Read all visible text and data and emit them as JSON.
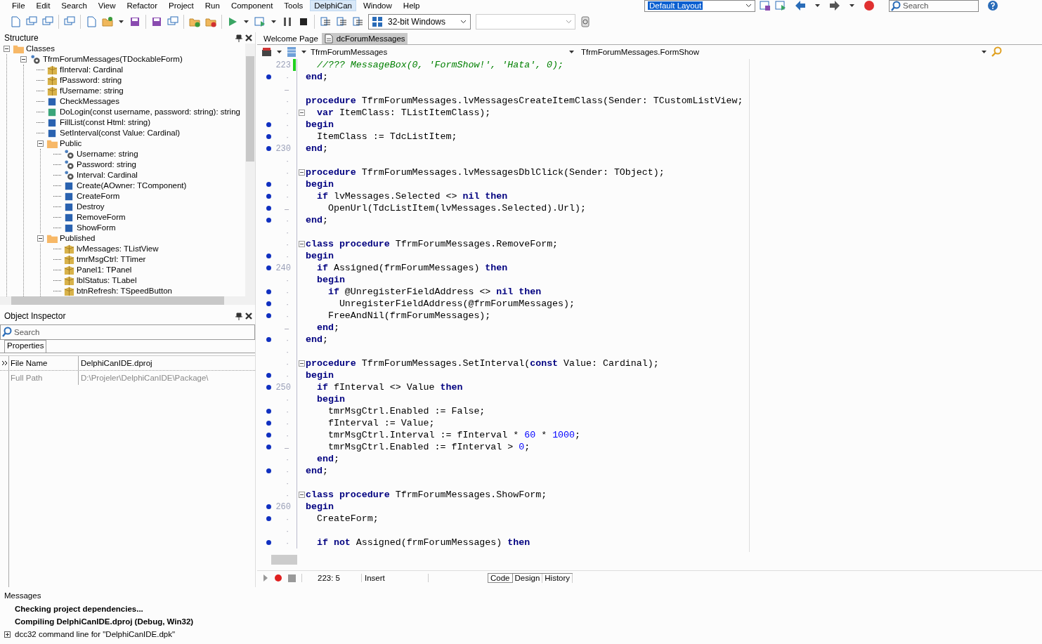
{
  "menu": [
    {
      "label": "File",
      "selected": false
    },
    {
      "label": "Edit",
      "selected": false
    },
    {
      "label": "Search",
      "selected": false
    },
    {
      "label": "View",
      "selected": false
    },
    {
      "label": "Refactor",
      "selected": false
    },
    {
      "label": "Project",
      "selected": false
    },
    {
      "label": "Run",
      "selected": false
    },
    {
      "label": "Component",
      "selected": false
    },
    {
      "label": "Tools",
      "selected": false
    },
    {
      "label": "DelphiCan",
      "selected": true
    },
    {
      "label": "Window",
      "selected": false
    },
    {
      "label": "Help",
      "selected": false
    }
  ],
  "layout_combo": {
    "value": "Default Layout"
  },
  "top_search": {
    "placeholder": "Search"
  },
  "platform_combo": {
    "value": "32-bit Windows"
  },
  "structure": {
    "title": "Structure",
    "tree": [
      {
        "label": "Classes",
        "kind": "folder",
        "expanded": true,
        "children": [
          {
            "label": "TfrmForumMessages(TDockableForm)",
            "kind": "class",
            "expanded": true,
            "children": [
              {
                "label": "fInterval: Cardinal",
                "kind": "field"
              },
              {
                "label": "fPassword: string",
                "kind": "field"
              },
              {
                "label": "fUsername: string",
                "kind": "field"
              },
              {
                "label": "CheckMessages",
                "kind": "method"
              },
              {
                "label": "DoLogin(const username, password: string): string",
                "kind": "function"
              },
              {
                "label": "FillList(const Html: string)",
                "kind": "method"
              },
              {
                "label": "SetInterval(const Value: Cardinal)",
                "kind": "method"
              },
              {
                "label": "Public",
                "kind": "folder",
                "expanded": true,
                "children": [
                  {
                    "label": "Username: string",
                    "kind": "property"
                  },
                  {
                    "label": "Password: string",
                    "kind": "property"
                  },
                  {
                    "label": "Interval: Cardinal",
                    "kind": "property"
                  },
                  {
                    "label": "Create(AOwner: TComponent)",
                    "kind": "method"
                  },
                  {
                    "label": "CreateForm",
                    "kind": "method"
                  },
                  {
                    "label": "Destroy",
                    "kind": "method"
                  },
                  {
                    "label": "RemoveForm",
                    "kind": "method"
                  },
                  {
                    "label": "ShowForm",
                    "kind": "method"
                  }
                ]
              },
              {
                "label": "Published",
                "kind": "folder",
                "expanded": true,
                "children": [
                  {
                    "label": "lvMessages: TListView",
                    "kind": "field"
                  },
                  {
                    "label": "tmrMsgCtrl: TTimer",
                    "kind": "field"
                  },
                  {
                    "label": "Panel1: TPanel",
                    "kind": "field"
                  },
                  {
                    "label": "lblStatus: TLabel",
                    "kind": "field"
                  },
                  {
                    "label": "btnRefresh: TSpeedButton",
                    "kind": "field"
                  }
                ]
              }
            ]
          }
        ]
      }
    ]
  },
  "object_inspector": {
    "title": "Object Inspector",
    "search": {
      "placeholder": "Search"
    },
    "tabs": [
      {
        "label": "Properties",
        "selected": true
      }
    ],
    "rows": [
      {
        "name": "File Name",
        "value": "DelphiCanIDE.dproj",
        "selected": true,
        "disabled": false
      },
      {
        "name": "Full Path",
        "value": "D:\\Projeler\\DelphiCanIDE\\Package\\",
        "selected": false,
        "disabled": true
      }
    ]
  },
  "editor": {
    "tabs": [
      {
        "label": "Welcome Page",
        "selected": false,
        "icon": false
      },
      {
        "label": "dcForumMessages",
        "selected": true,
        "icon": true
      }
    ],
    "class_combo": "TfrmForumMessages",
    "method_combo": "TfrmForumMessages.FormShow",
    "lines": [
      {
        "number": "223",
        "modified": true,
        "code": [
          {
            "kind": "comment",
            "text": "  //??? MessageBox(0, 'FormShow!', 'Hata', 0);"
          }
        ]
      },
      {
        "marker": "·",
        "dot": true,
        "code": [
          {
            "kind": "kw",
            "text": "end"
          },
          {
            "kind": "id",
            "text": ";"
          }
        ]
      },
      {
        "marker": "–"
      },
      {
        "marker": "·",
        "code": [
          {
            "kind": "kw",
            "text": "procedure"
          },
          {
            "kind": "id",
            "text": " TfrmForumMessages.lvMessagesCreateItemClass(Sender: TCustomListView;"
          }
        ]
      },
      {
        "marker": "·",
        "fold": true,
        "code": [
          {
            "kind": "kw",
            "text": "  var"
          },
          {
            "kind": "id",
            "text": " ItemClass: TListItemClass);"
          }
        ]
      },
      {
        "marker": "·",
        "dot": true,
        "code": [
          {
            "kind": "kw",
            "text": "begin"
          }
        ]
      },
      {
        "marker": "·",
        "dot": true,
        "code": [
          {
            "kind": "id",
            "text": "  ItemClass := TdcListItem;"
          }
        ]
      },
      {
        "number": "230",
        "dot": true,
        "code": [
          {
            "kind": "kw",
            "text": "end"
          },
          {
            "kind": "id",
            "text": ";"
          }
        ]
      },
      {
        "marker": "·"
      },
      {
        "marker": "·",
        "fold": true,
        "code": [
          {
            "kind": "kw",
            "text": "procedure"
          },
          {
            "kind": "id",
            "text": " TfrmForumMessages.lvMessagesDblClick(Sender: TObject);"
          }
        ]
      },
      {
        "marker": "·",
        "dot": true,
        "code": [
          {
            "kind": "kw",
            "text": "begin"
          }
        ]
      },
      {
        "marker": "·",
        "dot": true,
        "code": [
          {
            "kind": "kw",
            "text": "  if"
          },
          {
            "kind": "id",
            "text": " lvMessages.Selected <> "
          },
          {
            "kind": "kw",
            "text": "nil then"
          }
        ]
      },
      {
        "marker": "–",
        "dot": true,
        "code": [
          {
            "kind": "id",
            "text": "    OpenUrl(TdcListItem(lvMessages.Selected).Url);"
          }
        ]
      },
      {
        "marker": "·",
        "dot": true,
        "code": [
          {
            "kind": "kw",
            "text": "end"
          },
          {
            "kind": "id",
            "text": ";"
          }
        ]
      },
      {
        "marker": "·"
      },
      {
        "marker": "·",
        "fold": true,
        "code": [
          {
            "kind": "kw",
            "text": "class procedure"
          },
          {
            "kind": "id",
            "text": " TfrmForumMessages.RemoveForm;"
          }
        ]
      },
      {
        "marker": "·",
        "dot": true,
        "code": [
          {
            "kind": "kw",
            "text": "begin"
          }
        ]
      },
      {
        "number": "240",
        "dot": true,
        "code": [
          {
            "kind": "kw",
            "text": "  if"
          },
          {
            "kind": "id",
            "text": " Assigned(frmForumMessages) "
          },
          {
            "kind": "kw",
            "text": "then"
          }
        ]
      },
      {
        "marker": "·",
        "code": [
          {
            "kind": "kw",
            "text": "  begin"
          }
        ]
      },
      {
        "marker": "·",
        "dot": true,
        "code": [
          {
            "kind": "kw",
            "text": "    if"
          },
          {
            "kind": "id",
            "text": " @UnregisterFieldAddress <> "
          },
          {
            "kind": "kw",
            "text": "nil then"
          }
        ]
      },
      {
        "marker": "·",
        "dot": true,
        "code": [
          {
            "kind": "id",
            "text": "      UnregisterFieldAddress(@frmForumMessages);"
          }
        ]
      },
      {
        "marker": "·",
        "dot": true,
        "code": [
          {
            "kind": "id",
            "text": "    FreeAndNil(frmForumMessages);"
          }
        ]
      },
      {
        "marker": "–",
        "code": [
          {
            "kind": "kw",
            "text": "  end"
          },
          {
            "kind": "id",
            "text": ";"
          }
        ]
      },
      {
        "marker": "·",
        "dot": true,
        "code": [
          {
            "kind": "kw",
            "text": "end"
          },
          {
            "kind": "id",
            "text": ";"
          }
        ]
      },
      {
        "marker": "·"
      },
      {
        "marker": "·",
        "fold": true,
        "code": [
          {
            "kind": "kw",
            "text": "procedure"
          },
          {
            "kind": "id",
            "text": " TfrmForumMessages.SetInterval("
          },
          {
            "kind": "kw",
            "text": "const"
          },
          {
            "kind": "id",
            "text": " Value: Cardinal);"
          }
        ]
      },
      {
        "marker": "·",
        "dot": true,
        "code": [
          {
            "kind": "kw",
            "text": "begin"
          }
        ]
      },
      {
        "number": "250",
        "dot": true,
        "code": [
          {
            "kind": "kw",
            "text": "  if"
          },
          {
            "kind": "id",
            "text": " fInterval <> Value "
          },
          {
            "kind": "kw",
            "text": "then"
          }
        ]
      },
      {
        "marker": "·",
        "code": [
          {
            "kind": "kw",
            "text": "  begin"
          }
        ]
      },
      {
        "marker": "·",
        "dot": true,
        "code": [
          {
            "kind": "id",
            "text": "    tmrMsgCtrl.Enabled := False;"
          }
        ]
      },
      {
        "marker": "·",
        "dot": true,
        "code": [
          {
            "kind": "id",
            "text": "    fInterval := Value;"
          }
        ]
      },
      {
        "marker": "·",
        "dot": true,
        "code": [
          {
            "kind": "id",
            "text": "    tmrMsgCtrl.Interval := fInterval * "
          },
          {
            "kind": "num",
            "text": "60"
          },
          {
            "kind": "id",
            "text": " * "
          },
          {
            "kind": "num",
            "text": "1000"
          },
          {
            "kind": "id",
            "text": ";"
          }
        ]
      },
      {
        "marker": "–",
        "dot": true,
        "code": [
          {
            "kind": "id",
            "text": "    tmrMsgCtrl.Enabled := fInterval > "
          },
          {
            "kind": "num",
            "text": "0"
          },
          {
            "kind": "id",
            "text": ";"
          }
        ]
      },
      {
        "marker": "·",
        "code": [
          {
            "kind": "kw",
            "text": "  end"
          },
          {
            "kind": "id",
            "text": ";"
          }
        ]
      },
      {
        "marker": "·",
        "dot": true,
        "code": [
          {
            "kind": "kw",
            "text": "end"
          },
          {
            "kind": "id",
            "text": ";"
          }
        ]
      },
      {
        "marker": "·"
      },
      {
        "marker": "·",
        "fold": true,
        "code": [
          {
            "kind": "kw",
            "text": "class procedure"
          },
          {
            "kind": "id",
            "text": " TfrmForumMessages.ShowForm;"
          }
        ]
      },
      {
        "number": "260",
        "dot": true,
        "code": [
          {
            "kind": "kw",
            "text": "begin"
          }
        ]
      },
      {
        "marker": "·",
        "dot": true,
        "code": [
          {
            "kind": "id",
            "text": "  CreateForm;"
          }
        ]
      },
      {
        "marker": "·"
      },
      {
        "marker": "·",
        "dot": true,
        "code": [
          {
            "kind": "kw",
            "text": "  if not"
          },
          {
            "kind": "id",
            "text": " Assigned(frmForumMessages) "
          },
          {
            "kind": "kw",
            "text": "then"
          }
        ]
      }
    ],
    "status": {
      "position": "223:  5",
      "mode": "Insert"
    },
    "view_tabs": [
      {
        "label": "Code",
        "selected": true
      },
      {
        "label": "Design",
        "selected": false
      },
      {
        "label": "History",
        "selected": false
      }
    ]
  },
  "messages": {
    "title": "Messages",
    "items": [
      {
        "text": "Checking project dependencies...",
        "kind": "status",
        "expandable": false
      },
      {
        "text": "Compiling DelphiCanIDE.dproj (Debug, Win32)",
        "kind": "status",
        "expandable": false
      },
      {
        "text": "dcc32 command line for \"DelphiCanIDE.dpk\"",
        "kind": "detail",
        "expandable": true
      }
    ]
  }
}
